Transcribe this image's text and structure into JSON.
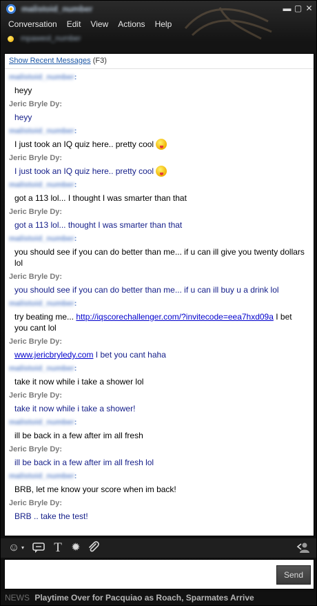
{
  "window": {
    "title": "malistoid_number",
    "status_text": "mpaweol_number"
  },
  "menu": [
    "Conversation",
    "Edit",
    "View",
    "Actions",
    "Help"
  ],
  "recent": {
    "link": "Show Recent Messages",
    "shortcut": "(F3)"
  },
  "messages": [
    {
      "sender": "malistoid_number",
      "self": false,
      "text": "heyy"
    },
    {
      "sender": "Jeric Bryle Dy",
      "self": true,
      "text": "heyy"
    },
    {
      "sender": "malistoid_number",
      "self": false,
      "text": "I just took an IQ quiz here.. pretty cool",
      "emoticon": "tongue-smiley-icon"
    },
    {
      "sender": "Jeric Bryle Dy",
      "self": true,
      "text": "I just took an IQ quiz here.. pretty cool",
      "emoticon": "tongue-smiley-icon"
    },
    {
      "sender": "malistoid_number",
      "self": false,
      "text": "got a 113 lol... I thought I was smarter than that"
    },
    {
      "sender": "Jeric Bryle Dy",
      "self": true,
      "text": "got a 113 lol... thought I was smarter than that"
    },
    {
      "sender": "malistoid_number",
      "self": false,
      "text": "you should see if you can do better than me... if u can ill give you twenty dollars lol"
    },
    {
      "sender": "Jeric Bryle Dy",
      "self": true,
      "text": "you should see if you can do better than me... if u can ill buy u a drink lol"
    },
    {
      "sender": "malistoid_number",
      "self": false,
      "text_before": "try beating me... ",
      "link": "http://iqscorechallenger.com/?invitecode=eea7hxd09a",
      "text_after": " I bet you cant lol"
    },
    {
      "sender": "Jeric Bryle Dy",
      "self": true,
      "link": "www.jericbryledy.com",
      "text_after": " I bet you cant haha"
    },
    {
      "sender": "malistoid_number",
      "self": false,
      "text": "take it now while i take a shower lol"
    },
    {
      "sender": "Jeric Bryle Dy",
      "self": true,
      "text": "take it now while i take a shower!"
    },
    {
      "sender": "malistoid_number",
      "self": false,
      "text": "ill be back in a few after im all fresh"
    },
    {
      "sender": "Jeric Bryle Dy",
      "self": true,
      "text": "ill be back in a few after im all fresh lol"
    },
    {
      "sender": "malistoid_number",
      "self": false,
      "text": "BRB, let me know your score when im back!"
    },
    {
      "sender": "Jeric Bryle Dy",
      "self": true,
      "text": "BRB .. take the test!"
    }
  ],
  "composer": {
    "send_label": "Send"
  },
  "news": {
    "label": "NEWS",
    "headline": "Playtime Over for Pacquiao as Roach, Sparmates Arrive"
  }
}
